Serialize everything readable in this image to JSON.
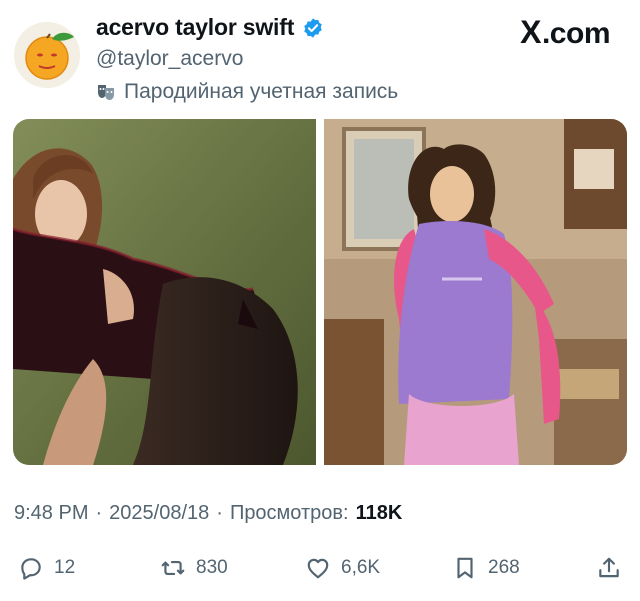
{
  "author": {
    "display_name": "acervo taylor swift",
    "handle": "@taylor_acervo",
    "parody_label": "Пародийная учетная запись",
    "verified": true,
    "avatar_icon": "orange-emoji-avatar"
  },
  "brand": {
    "x_glyph": "X",
    "suffix": ".com"
  },
  "media": {
    "count": 2,
    "images": [
      {
        "name": "photo-left",
        "description_icon": "photo"
      },
      {
        "name": "photo-right",
        "description_icon": "photo"
      }
    ]
  },
  "meta": {
    "time": "9:48 PM",
    "date": "2025/08/18",
    "views_label": "Просмотров:",
    "views_count": "118K",
    "separator": "·"
  },
  "actions": {
    "replies": "12",
    "reposts": "830",
    "likes": "6,6K",
    "bookmarks": "268"
  },
  "colors": {
    "verified_blue": "#1d9bf0",
    "text_primary": "#0f1419",
    "text_secondary": "#536471"
  }
}
